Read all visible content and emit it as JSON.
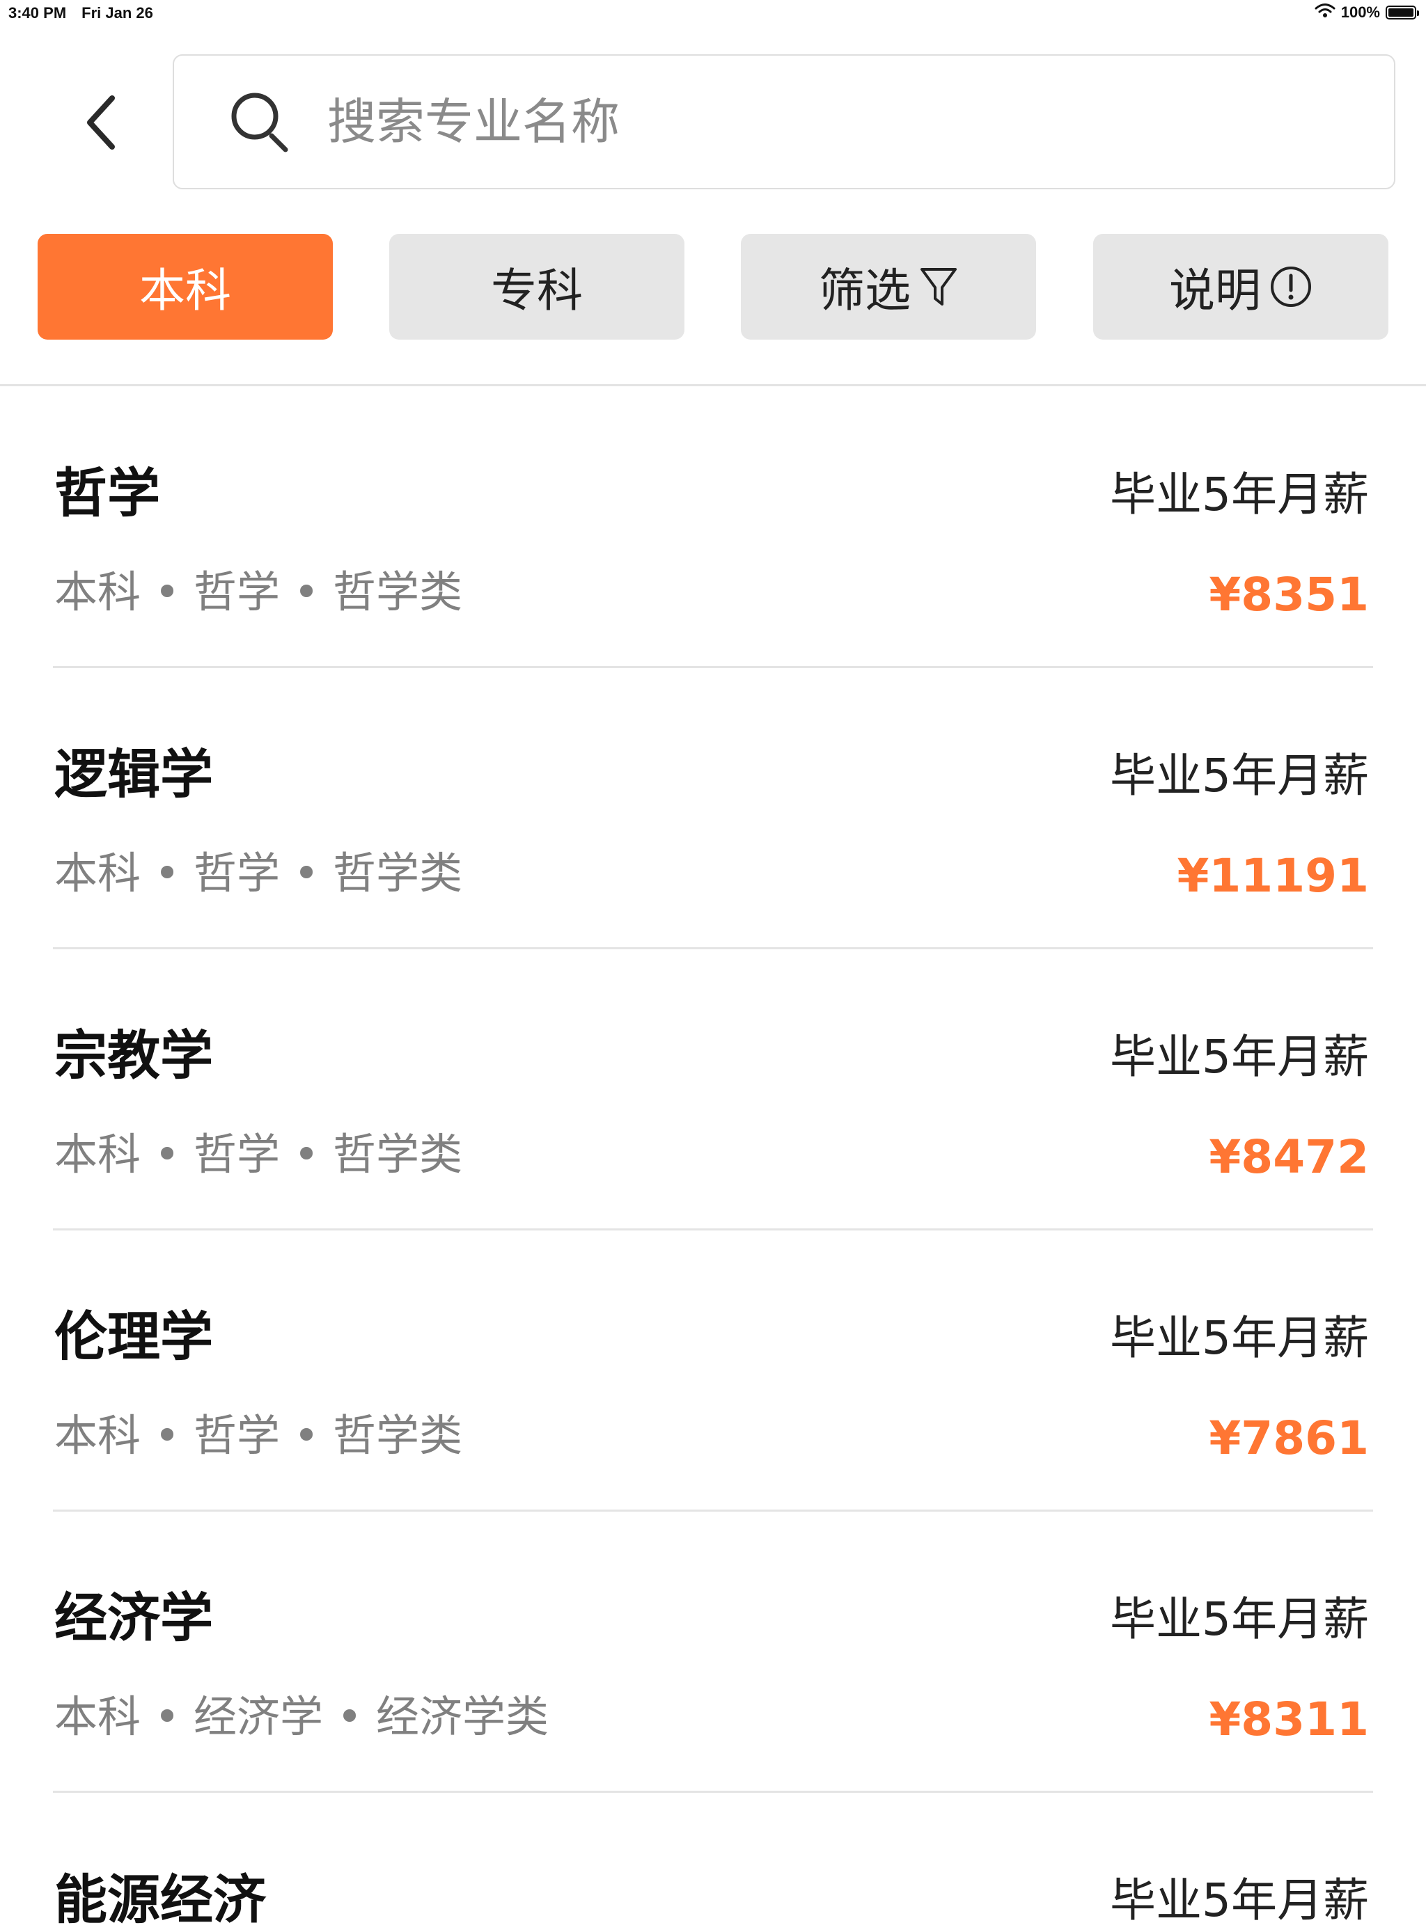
{
  "status_bar": {
    "time": "3:40 PM",
    "date": "Fri Jan 26",
    "battery": "100%",
    "battery_level": 1.0
  },
  "search": {
    "placeholder": "搜索专业名称",
    "value": ""
  },
  "tabs": [
    {
      "label": "本科",
      "active": true
    },
    {
      "label": "专科",
      "active": false
    },
    {
      "label": "筛选",
      "icon": "filter-icon",
      "active": false
    },
    {
      "label": "说明",
      "icon": "info-circle-icon",
      "active": false
    }
  ],
  "majors": [
    {
      "name": "哲学",
      "meta": "本科 • 哲学 • 哲学类",
      "salary_label": "毕业5年月薪",
      "salary": "¥8351"
    },
    {
      "name": "逻辑学",
      "meta": "本科 • 哲学 • 哲学类",
      "salary_label": "毕业5年月薪",
      "salary": "¥11191"
    },
    {
      "name": "宗教学",
      "meta": "本科 • 哲学 • 哲学类",
      "salary_label": "毕业5年月薪",
      "salary": "¥8472"
    },
    {
      "name": "伦理学",
      "meta": "本科 • 哲学 • 哲学类",
      "salary_label": "毕业5年月薪",
      "salary": "¥7861"
    },
    {
      "name": "经济学",
      "meta": "本科 • 经济学 • 经济学类",
      "salary_label": "毕业5年月薪",
      "salary": "¥8311"
    }
  ],
  "partial_major": {
    "name": "能源经济",
    "salary_label": "毕业5年月薪"
  },
  "colors": {
    "accent": "#ff7633",
    "tab_inactive": "#e6e6e6",
    "meta_text": "#808080"
  }
}
